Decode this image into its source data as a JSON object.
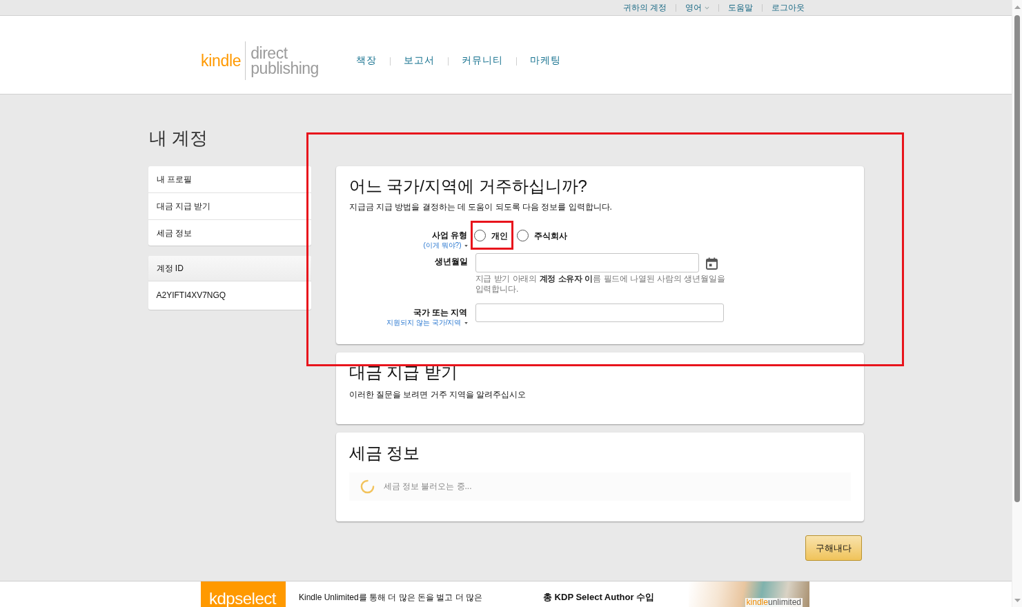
{
  "top_links": [
    {
      "label": "귀하의 계정",
      "dropdown": false
    },
    {
      "label": "영어",
      "dropdown": true
    },
    {
      "label": "도움말",
      "dropdown": false
    },
    {
      "label": "로그아웃",
      "dropdown": false
    }
  ],
  "logo": {
    "brand": "kindle",
    "line_1": "direct",
    "line_2": "publishing"
  },
  "nav": [
    {
      "label": "책장"
    },
    {
      "label": "보고서"
    },
    {
      "label": "커뮤니티"
    },
    {
      "label": "마케팅"
    }
  ],
  "page_title": "내 계정",
  "sidebar": {
    "items": [
      {
        "label": "내 프로필"
      },
      {
        "label": "대금 지급 받기"
      },
      {
        "label": "세금 정보"
      }
    ],
    "account_id": {
      "label": "계정 ID",
      "value": "A2YIFTI4XV7NGQ"
    }
  },
  "residence": {
    "highlighted": true,
    "title": "어느 국가/지역에 거주하십니까?",
    "subtitle": "지급금 지급 방법을 결정하는 데 도움이 되도록 다음 정보를 입력합니다.",
    "fields": [
      {
        "kind": "radio",
        "label": "사업 유형",
        "help_link": "(이게 뭐야?)",
        "options": [
          {
            "label": "개인",
            "selected": false,
            "highlighted": true
          },
          {
            "label": "주식회사",
            "selected": false,
            "highlighted": false
          }
        ]
      },
      {
        "kind": "date",
        "label": "생년월일",
        "hint": "지급 받기 아래의 **계정 소유자 이**름 필드에 나열된 사람의 생년월일을 입력합니다."
      },
      {
        "kind": "select",
        "label": "국가 또는 지역",
        "help_link": "지원되지 않는 국가/지역"
      }
    ]
  },
  "payment": {
    "title": "대금 지급 받기",
    "subtitle": "이러한 질문을 보려면 거주 지역을 알려주십시오"
  },
  "tax": {
    "title": "세금 정보",
    "loading_text": "세금 정보 불러오는 중..."
  },
  "submit_button": "구해내다",
  "banner": {
    "logo_1": "kdp",
    "logo_2": "select",
    "text": "Kindle Unlimited를 통해 더 많은 돈을 벌고 더 많은",
    "headline": "총 KDP Select Author 수입",
    "image_logo_1": "kindle",
    "image_logo_2": "unlimited"
  }
}
